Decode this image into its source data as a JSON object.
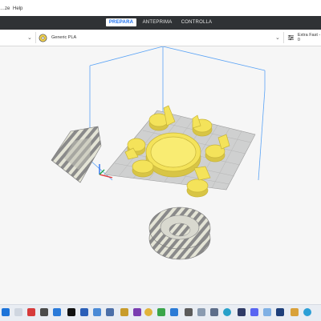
{
  "menu": {
    "items": [
      "…ze",
      "Help"
    ]
  },
  "tabs": [
    {
      "label": "PREPARA",
      "active": true
    },
    {
      "label": "ANTEPRIMA",
      "active": false
    },
    {
      "label": "CONTROLLA",
      "active": false
    }
  ],
  "toolbar": {
    "material": "Generic PLA",
    "profile": "Extra Fast - 0"
  },
  "colors": {
    "accent": "#196ef0",
    "header": "#2f3235",
    "model_yellow": "#f5e35a",
    "build_volume_line": "#4b9cf5",
    "stripe_grey": "#8c8c8c",
    "stripe_light": "#e6e6d2"
  },
  "taskbar": {
    "icons": [
      "windows-start-icon",
      "search-icon",
      "explorer-icon",
      "store-icon",
      "mail-icon",
      "calendar-icon",
      "word-icon",
      "settings-icon",
      "photos-icon",
      "chrome-icon",
      "edge-icon",
      "folder-icon",
      "media-icon",
      "teams-icon",
      "cura-icon",
      "ide-icon",
      "app-icon",
      "app-icon-2",
      "terminal-icon",
      "discord-icon",
      "printer-icon",
      "chrome-icon-2",
      "app-icon-3",
      "app-icon-4",
      "app-icon-5"
    ]
  }
}
